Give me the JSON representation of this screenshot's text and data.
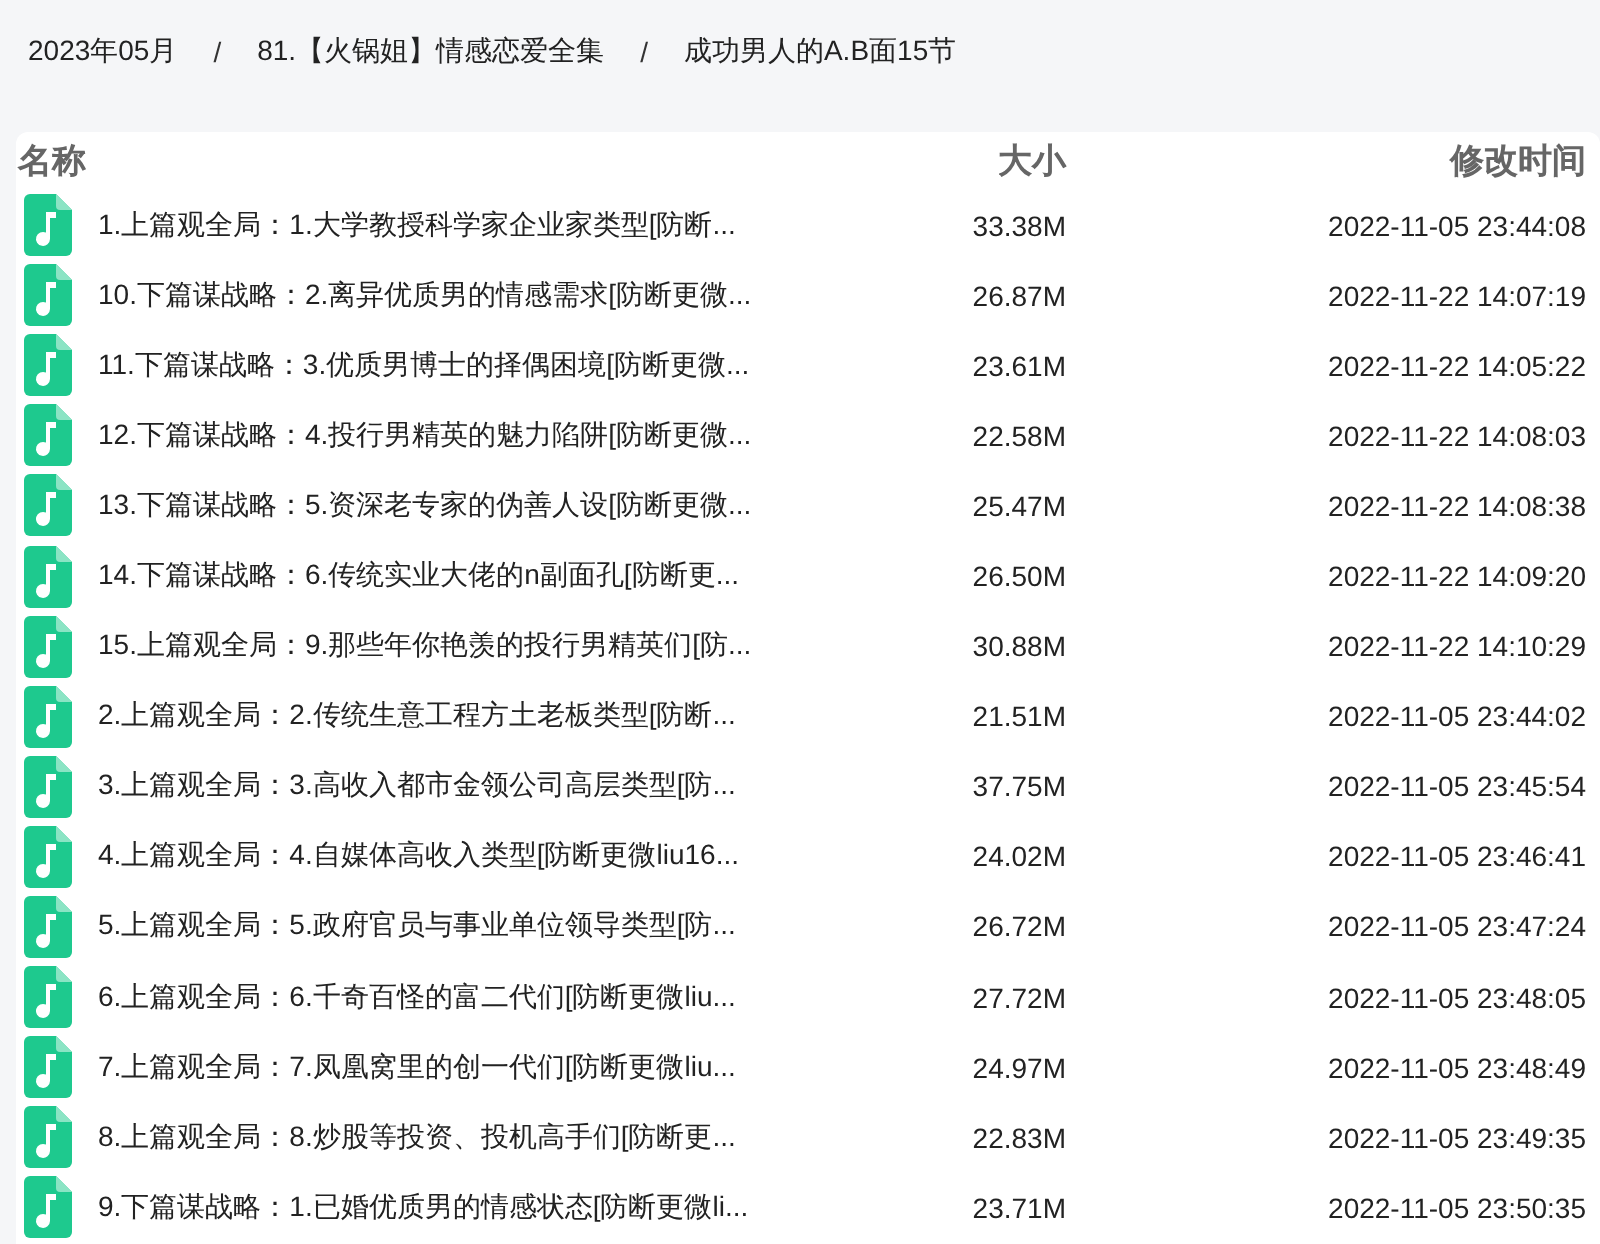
{
  "breadcrumb": [
    "2023年05月",
    "81.【火锅姐】情感恋爱全集",
    "成功男人的A.B面15节"
  ],
  "breadcrumb_separator": "/",
  "table": {
    "columns": [
      "名称",
      "大小",
      "修改时间"
    ],
    "rows": [
      {
        "name": "1.上篇观全局：1.大学教授科学家企业家类型[防断...",
        "size": "33.38M",
        "modified": "2022-11-05 23:44:08"
      },
      {
        "name": "10.下篇谋战略：2.离异优质男的情感需求[防断更微...",
        "size": "26.87M",
        "modified": "2022-11-22 14:07:19"
      },
      {
        "name": "11.下篇谋战略：3.优质男博士的择偶困境[防断更微...",
        "size": "23.61M",
        "modified": "2022-11-22 14:05:22"
      },
      {
        "name": "12.下篇谋战略：4.投行男精英的魅力陷阱[防断更微...",
        "size": "22.58M",
        "modified": "2022-11-22 14:08:03"
      },
      {
        "name": "13.下篇谋战略：5.资深老专家的伪善人设[防断更微...",
        "size": "25.47M",
        "modified": "2022-11-22 14:08:38"
      },
      {
        "name": "14.下篇谋战略：6.传统实业大佬的n副面孔[防断更...",
        "size": "26.50M",
        "modified": "2022-11-22 14:09:20"
      },
      {
        "name": "15.上篇观全局：9.那些年你艳羡的投行男精英们[防...",
        "size": "30.88M",
        "modified": "2022-11-22 14:10:29"
      },
      {
        "name": "2.上篇观全局：2.传统生意工程方土老板类型[防断...",
        "size": "21.51M",
        "modified": "2022-11-05 23:44:02"
      },
      {
        "name": "3.上篇观全局：3.高收入都市金领公司高层类型[防...",
        "size": "37.75M",
        "modified": "2022-11-05 23:45:54"
      },
      {
        "name": "4.上篇观全局：4.自媒体高收入类型[防断更微liu16...",
        "size": "24.02M",
        "modified": "2022-11-05 23:46:41"
      },
      {
        "name": "5.上篇观全局：5.政府官员与事业单位领导类型[防...",
        "size": "26.72M",
        "modified": "2022-11-05 23:47:24"
      },
      {
        "name": "6.上篇观全局：6.千奇百怪的富二代们[防断更微liu...",
        "size": "27.72M",
        "modified": "2022-11-05 23:48:05"
      },
      {
        "name": "7.上篇观全局：7.凤凰窝里的创一代们[防断更微liu...",
        "size": "24.97M",
        "modified": "2022-11-05 23:48:49"
      },
      {
        "name": "8.上篇观全局：8.炒股等投资、投机高手们[防断更...",
        "size": "22.83M",
        "modified": "2022-11-05 23:49:35"
      },
      {
        "name": "9.下篇谋战略：1.已婚优质男的情感状态[防断更微li...",
        "size": "23.71M",
        "modified": "2022-11-05 23:50:35"
      }
    ]
  }
}
